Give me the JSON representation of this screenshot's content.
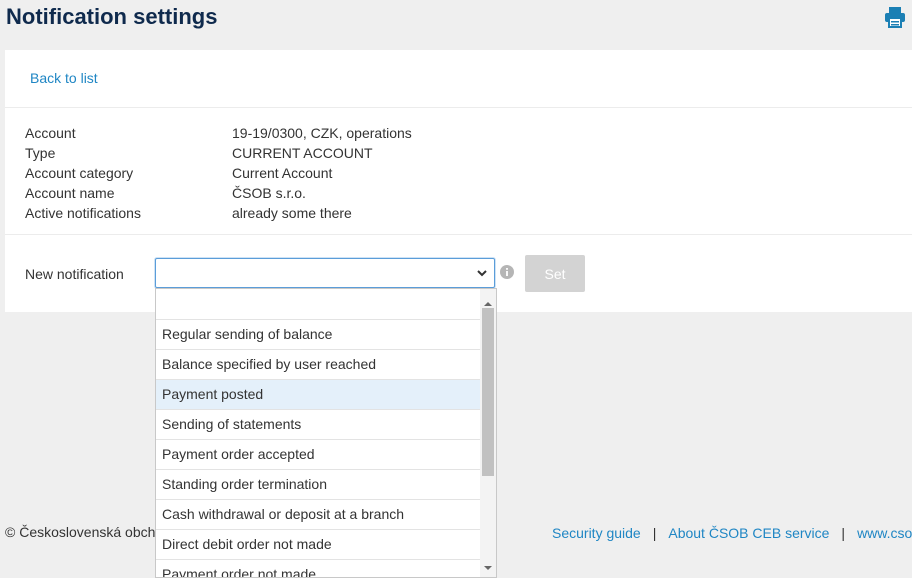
{
  "header": {
    "title": "Notification settings",
    "print_icon": "print-icon"
  },
  "card": {
    "back_label": "Back to list",
    "details": [
      {
        "label": "Account",
        "value": "19-19/0300, CZK, operations"
      },
      {
        "label": "Type",
        "value": "CURRENT ACCOUNT"
      },
      {
        "label": "Account category",
        "value": "Current Account"
      },
      {
        "label": "Account name",
        "value": "ČSOB s.r.o."
      },
      {
        "label": "Active notifications",
        "value": "already some there"
      }
    ],
    "new_notification_label": "New notification",
    "select_value": "",
    "set_label": "Set"
  },
  "dropdown": {
    "options": [
      "",
      "Regular sending of balance",
      "Balance specified by user reached",
      "Payment posted",
      "Sending of statements",
      "Payment order accepted",
      "Standing order termination",
      "Cash withdrawal or deposit at a branch",
      "Direct debit order not made",
      "Payment order not made"
    ],
    "highlighted": "Payment posted"
  },
  "footer": {
    "copyright": "© Československá obch",
    "links": [
      "Security guide",
      "About ČSOB CEB service",
      "www.cso"
    ]
  },
  "colors": {
    "accent": "#1f86c4",
    "title": "#0f2a4d",
    "highlight": "#e4f0fa"
  }
}
